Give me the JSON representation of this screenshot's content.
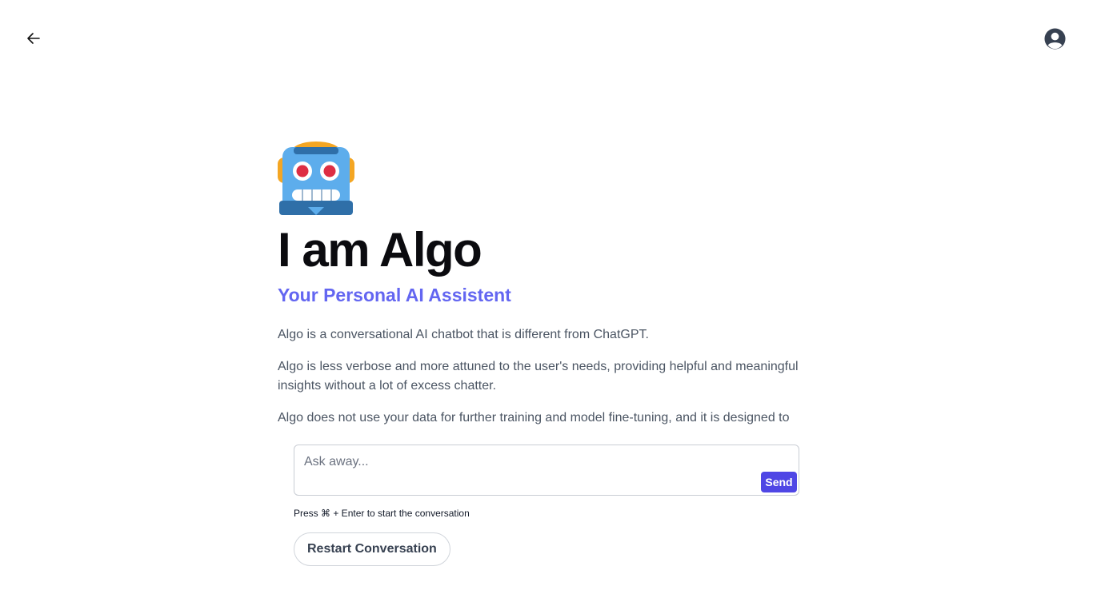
{
  "header": {
    "back_icon": "arrow-left-icon",
    "account_icon": "user-circle-icon"
  },
  "hero": {
    "avatar_icon": "robot-emoji",
    "title": "I am Algo",
    "subtitle": "Your Personal AI Assistent",
    "paragraphs": [
      "Algo is a conversational AI chatbot that is different from ChatGPT.",
      "Algo is less verbose and more attuned to the user's needs, providing helpful and meaningful insights without a lot of excess chatter.",
      "Algo does not use your data for further training and model fine-tuning, and it is designed to"
    ]
  },
  "composer": {
    "input_value": "",
    "input_placeholder": "Ask away...",
    "send_label": "Send",
    "hint": "Press ⌘ + Enter to start the conversation",
    "restart_label": "Restart Conversation"
  },
  "colors": {
    "accent": "#6366f1",
    "send_bg": "#4f46e5",
    "body_text": "#4b5563"
  }
}
